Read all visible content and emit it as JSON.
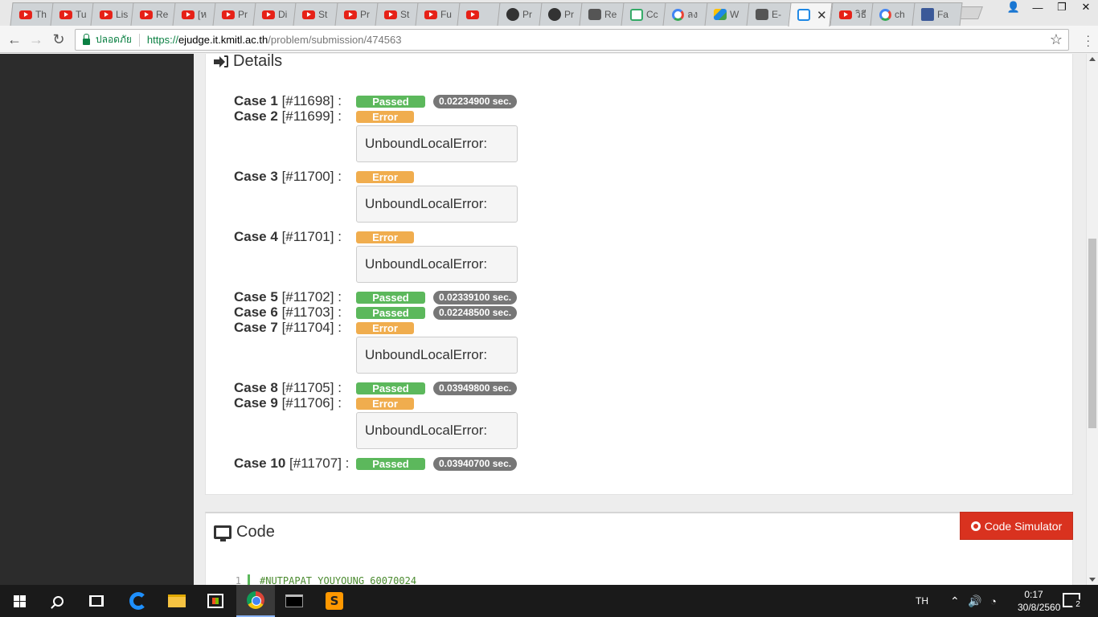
{
  "browser": {
    "tabs": [
      {
        "title": "Th",
        "icon": "youtube-icon"
      },
      {
        "title": "Tu",
        "icon": "youtube-icon"
      },
      {
        "title": "Lis",
        "icon": "youtube-icon"
      },
      {
        "title": "Re",
        "icon": "youtube-icon"
      },
      {
        "title": "[ห",
        "icon": "youtube-icon"
      },
      {
        "title": "Pr",
        "icon": "youtube-icon"
      },
      {
        "title": "Di",
        "icon": "youtube-icon"
      },
      {
        "title": "St",
        "icon": "youtube-icon"
      },
      {
        "title": "Pr",
        "icon": "youtube-icon"
      },
      {
        "title": "St",
        "icon": "youtube-icon"
      },
      {
        "title": "Fu",
        "icon": "youtube-icon"
      },
      {
        "title": "",
        "icon": "youtube-icon"
      },
      {
        "title": "Pr",
        "icon": "github-icon"
      },
      {
        "title": "Pr",
        "icon": "github-icon"
      },
      {
        "title": "Re",
        "icon": "page-icon"
      },
      {
        "title": "Cc",
        "icon": "grid-icon"
      },
      {
        "title": "ลง",
        "icon": "google-icon"
      },
      {
        "title": "W",
        "icon": "drive-icon"
      },
      {
        "title": "E-",
        "icon": "page-icon"
      },
      {
        "title": "",
        "icon": "it-icon",
        "active": true
      },
      {
        "title": "วิธี",
        "icon": "youtube-icon"
      },
      {
        "title": "ch",
        "icon": "google-icon"
      },
      {
        "title": "Fa",
        "icon": "facebook-icon"
      }
    ],
    "active_tab_close": "✕",
    "secure_label": "ปลอดภัย",
    "url_proto": "https://",
    "url_host": "ejudge.it.kmitl.ac.th",
    "url_path": "/problem/submission/474563"
  },
  "details": {
    "title": "Details",
    "cases": [
      {
        "name": "Case 1",
        "id": "[#11698] :",
        "status": "Passed",
        "time": "0.02234900 sec.",
        "error": null
      },
      {
        "name": "Case 2",
        "id": "[#11699] :",
        "status": "Error",
        "time": null,
        "error": "UnboundLocalError:"
      },
      {
        "name": "Case 3",
        "id": "[#11700] :",
        "status": "Error",
        "time": null,
        "error": "UnboundLocalError:"
      },
      {
        "name": "Case 4",
        "id": "[#11701] :",
        "status": "Error",
        "time": null,
        "error": "UnboundLocalError:"
      },
      {
        "name": "Case 5",
        "id": "[#11702] :",
        "status": "Passed",
        "time": "0.02339100 sec.",
        "error": null
      },
      {
        "name": "Case 6",
        "id": "[#11703] :",
        "status": "Passed",
        "time": "0.02248500 sec.",
        "error": null
      },
      {
        "name": "Case 7",
        "id": "[#11704] :",
        "status": "Error",
        "time": null,
        "error": "UnboundLocalError:"
      },
      {
        "name": "Case 8",
        "id": "[#11705] :",
        "status": "Passed",
        "time": "0.03949800 sec.",
        "error": null
      },
      {
        "name": "Case 9",
        "id": "[#11706] :",
        "status": "Error",
        "time": null,
        "error": "UnboundLocalError:"
      },
      {
        "name": "Case 10",
        "id": "[#11707] :",
        "status": "Passed",
        "time": "0.03940700 sec.",
        "error": null
      }
    ]
  },
  "code": {
    "title": "Code",
    "simulator_label": "Code Simulator",
    "line_number": "1",
    "first_line": "#NUTPAPAT YOUYOUNG 60070024"
  },
  "taskbar": {
    "lang": "TH",
    "time": "0:17",
    "date": "30/8/2560",
    "notification_count": "2"
  }
}
